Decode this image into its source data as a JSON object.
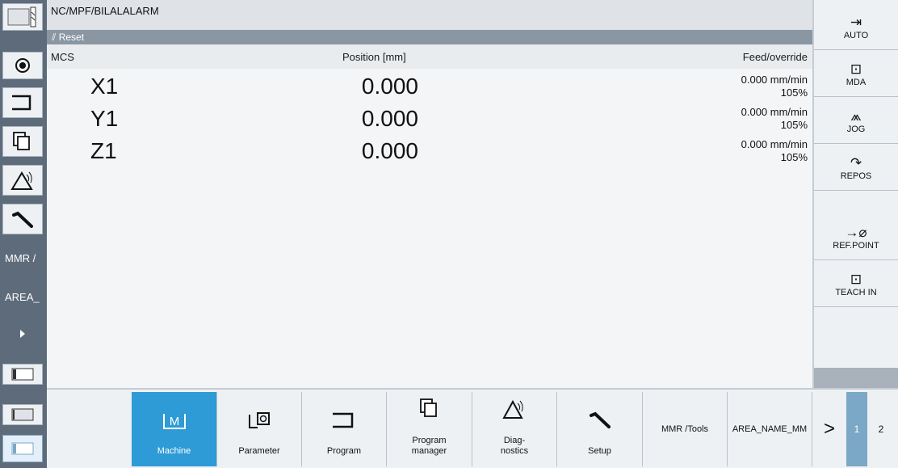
{
  "header": {
    "program_path": "NC/MPF/BILALALARM",
    "channel_state": "Reset",
    "columns": {
      "coord_system": "MCS",
      "position": "Position [mm]",
      "feed": "Feed/override"
    }
  },
  "axes": [
    {
      "name": "X1",
      "position": "0.000",
      "feed": "0.000 mm/min",
      "override": "105%"
    },
    {
      "name": "Y1",
      "position": "0.000",
      "feed": "0.000 mm/min",
      "override": "105%"
    },
    {
      "name": "Z1",
      "position": "0.000",
      "feed": "0.000 mm/min",
      "override": "105%"
    }
  ],
  "left_bar": {
    "mmr_label": "MMR /",
    "area_label": "AREA_"
  },
  "right_softkeys": [
    {
      "label": "AUTO",
      "icon": "auto-icon"
    },
    {
      "label": "MDA",
      "icon": "mda-icon"
    },
    {
      "label": "JOG",
      "icon": "jog-icon"
    },
    {
      "label": "REPOS",
      "icon": "repos-icon"
    },
    {
      "label": "REF.POINT",
      "icon": "ref-point-icon"
    },
    {
      "label": "TEACH IN",
      "icon": "teach-in-icon"
    }
  ],
  "bottom_softkeys": [
    {
      "label": "Machine",
      "icon": "machine-icon",
      "active": true
    },
    {
      "label": "Parameter",
      "icon": "parameter-icon"
    },
    {
      "label": "Program",
      "icon": "program-icon"
    },
    {
      "label": "Program\nmanager",
      "icon": "program-manager-icon"
    },
    {
      "label": "Diag-\nnostics",
      "icon": "diagnostics-icon"
    },
    {
      "label": "Setup",
      "icon": "setup-icon"
    },
    {
      "label": "MMR /Tools"
    },
    {
      "label": "AREA_NAME_MM"
    }
  ],
  "pager": {
    "next": ">",
    "page1": "1",
    "page2": "2"
  },
  "colors": {
    "active_softkey": "#2e9bd6",
    "sidebar": "#5e6b7a",
    "reset_bar": "#8a97a3"
  }
}
